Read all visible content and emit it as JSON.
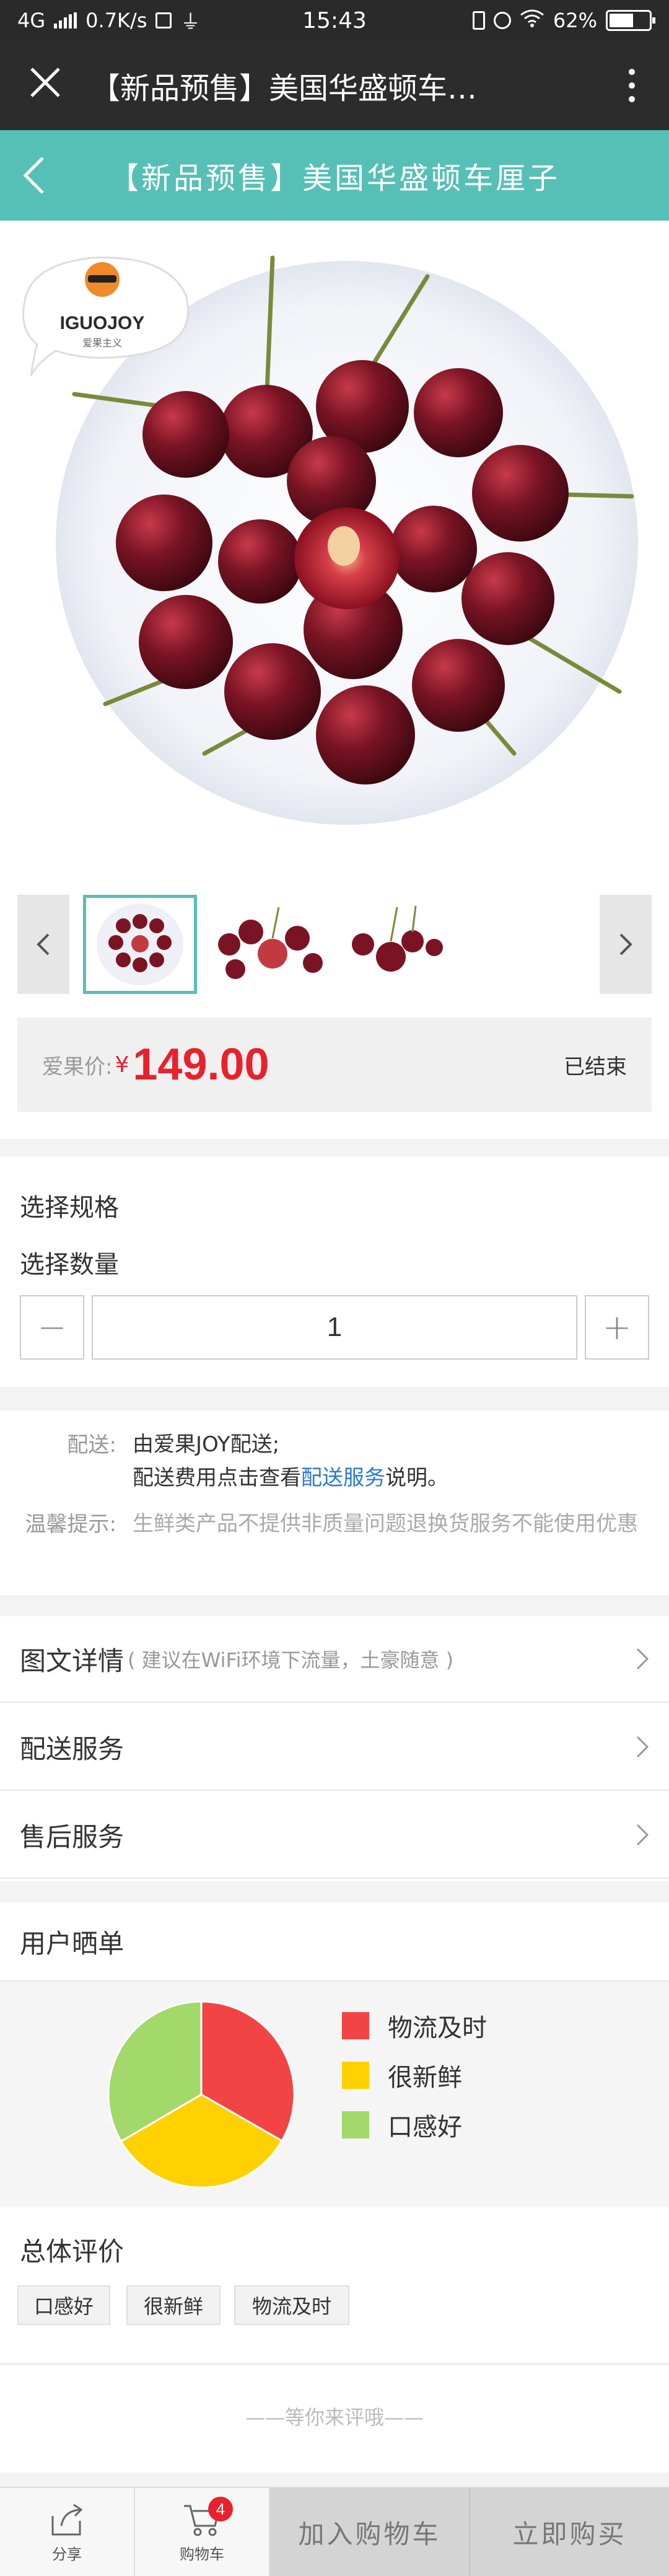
{
  "status_bar": {
    "network": "4G",
    "speed": "0.7K/s",
    "time": "15:43",
    "battery": "62%",
    "battery_level": 0.62
  },
  "browser": {
    "title": "【新品预售】美国华盛顿车…",
    "close_icon": "close-icon",
    "more_icon": "more-vertical-icon"
  },
  "header": {
    "title": "【新品预售】美国华盛顿车厘子",
    "back_icon": "back-arrow-icon",
    "accent": "#56c0b7"
  },
  "hero": {
    "brand_logo_text": "IGUOJOY",
    "brand_logo_sub": "爱果主义"
  },
  "price": {
    "label": "爱果价:",
    "currency": "¥",
    "value": "149.00",
    "status": "已结束",
    "color": "#e8212d"
  },
  "spec": {
    "select_spec_label": "选择规格",
    "select_qty_label": "选择数量",
    "quantity": "1",
    "minus": "−",
    "plus": "+"
  },
  "delivery": {
    "shipping_key": "配送:",
    "shipping_line1": "由爱果JOY配送;",
    "shipping_line2_pre": "配送费用点击查看",
    "shipping_link": "配送服务",
    "shipping_line2_post": "说明。",
    "tips_key": "温馨提示:",
    "tips_text": "生鲜类产品不提供非质量问题退换货服务不能使用优惠"
  },
  "details": {
    "items": [
      {
        "title": "图文详情",
        "note": "( 建议在WiFi环境下流量，土豪随意 )"
      },
      {
        "title": "配送服务",
        "note": ""
      },
      {
        "title": "售后服务",
        "note": ""
      }
    ]
  },
  "reviews": {
    "title": "用户晒单"
  },
  "chart_data": {
    "type": "pie",
    "labels": [
      "物流及时",
      "很新鲜",
      "口感好"
    ],
    "values": [
      33.3,
      33.3,
      33.4
    ],
    "colors": [
      "#f24444",
      "#ffd100",
      "#a2d96a"
    ]
  },
  "overall": {
    "title": "总体评价",
    "tags": [
      "口感好",
      "很新鲜",
      "物流及时"
    ],
    "empty_text": "——等你来评哦——"
  },
  "bottom_bar": {
    "share_label": "分享",
    "cart_label": "购物车",
    "cart_count": "4",
    "add_to_cart": "加入购物车",
    "buy_now": "立即购买"
  }
}
